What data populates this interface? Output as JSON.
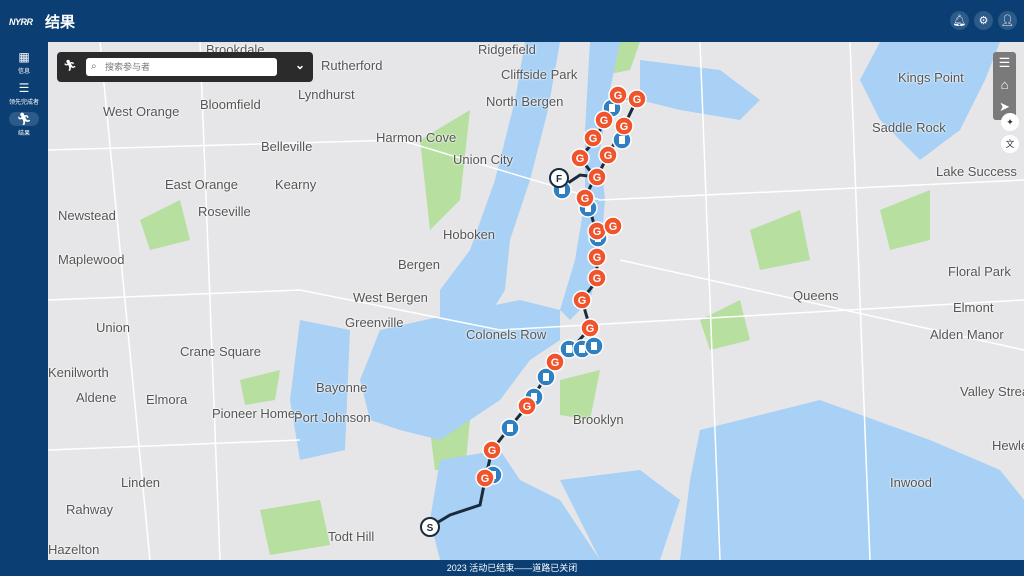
{
  "header": {
    "logo": "NYRR",
    "title": "结果",
    "icons": [
      "bell-icon",
      "gear-icon",
      "user-icon"
    ]
  },
  "sidebar": {
    "items": [
      {
        "label": "信息",
        "icon": "dashboard-icon"
      },
      {
        "label": "领先完成者",
        "icon": "list-icon"
      },
      {
        "label": "结果",
        "icon": "runner-icon",
        "active": true
      }
    ]
  },
  "search": {
    "placeholder": "搜索参与者"
  },
  "map": {
    "labels": [
      "Brookdale",
      "Rutherford",
      "Ridgefield",
      "Cliffside Park",
      "Kings Point",
      "West Orange",
      "Bloomfield",
      "Lyndhurst",
      "North Bergen",
      "Saddle Rock",
      "Belleville",
      "Harmon Cove",
      "Union City",
      "Lake Success",
      "East Orange",
      "Kearny",
      "Newstead",
      "Roseville",
      "Hoboken",
      "Maplewood",
      "Bergen",
      "Floral Park",
      "West Bergen",
      "Queens",
      "Elmont",
      "Union",
      "Greenville",
      "Colonels Row",
      "Alden Manor",
      "Crane Square",
      "Kenilworth",
      "Bayonne",
      "Aldene",
      "Elmora",
      "Pioneer Homes",
      "Port Johnson",
      "Brooklyn",
      "Valley Stream",
      "Linden",
      "Hewlett Harbor",
      "Rahway",
      "Inwood",
      "Todt Hill",
      "Hazelton"
    ],
    "start_label": "S",
    "finish_label": "F",
    "colors": {
      "water": "#a8d1f5",
      "land": "#e6e6e8",
      "park": "#b6dfa0",
      "route": "#1a2b3c",
      "gatorade": "#f0542d",
      "water_station": "#2f7fc1"
    },
    "controls": [
      "menu-icon",
      "home-icon",
      "locate-icon",
      "sparkle-icon",
      "translate-icon"
    ]
  },
  "footer": {
    "status": "2023 活动已结束——道路已关闭"
  }
}
